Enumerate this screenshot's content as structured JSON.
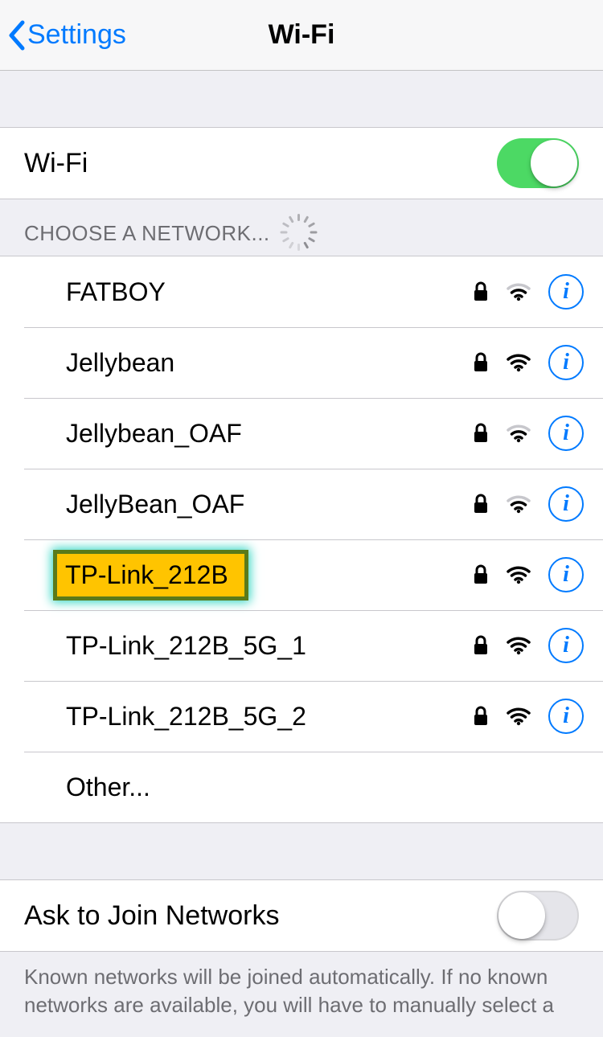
{
  "header": {
    "back_label": "Settings",
    "title": "Wi-Fi"
  },
  "wifi_toggle": {
    "label": "Wi-Fi",
    "on": true
  },
  "choose_header": "CHOOSE A NETWORK...",
  "networks": [
    {
      "name": "FATBOY",
      "secured": true,
      "signal": 2,
      "highlighted": false
    },
    {
      "name": "Jellybean",
      "secured": true,
      "signal": 3,
      "highlighted": false
    },
    {
      "name": "Jellybean_OAF",
      "secured": true,
      "signal": 2,
      "highlighted": false
    },
    {
      "name": "JellyBean_OAF",
      "secured": true,
      "signal": 2,
      "highlighted": false
    },
    {
      "name": "TP-Link_212B",
      "secured": true,
      "signal": 3,
      "highlighted": true
    },
    {
      "name": "TP-Link_212B_5G_1",
      "secured": true,
      "signal": 3,
      "highlighted": false
    },
    {
      "name": "TP-Link_212B_5G_2",
      "secured": true,
      "signal": 3,
      "highlighted": false
    }
  ],
  "other_label": "Other...",
  "ask_join": {
    "label": "Ask to Join Networks",
    "on": false
  },
  "footer": "Known networks will be joined automatically. If no known networks are available, you will have to manually select a",
  "colors": {
    "accent": "#007aff",
    "toggle_on": "#4cd964"
  }
}
